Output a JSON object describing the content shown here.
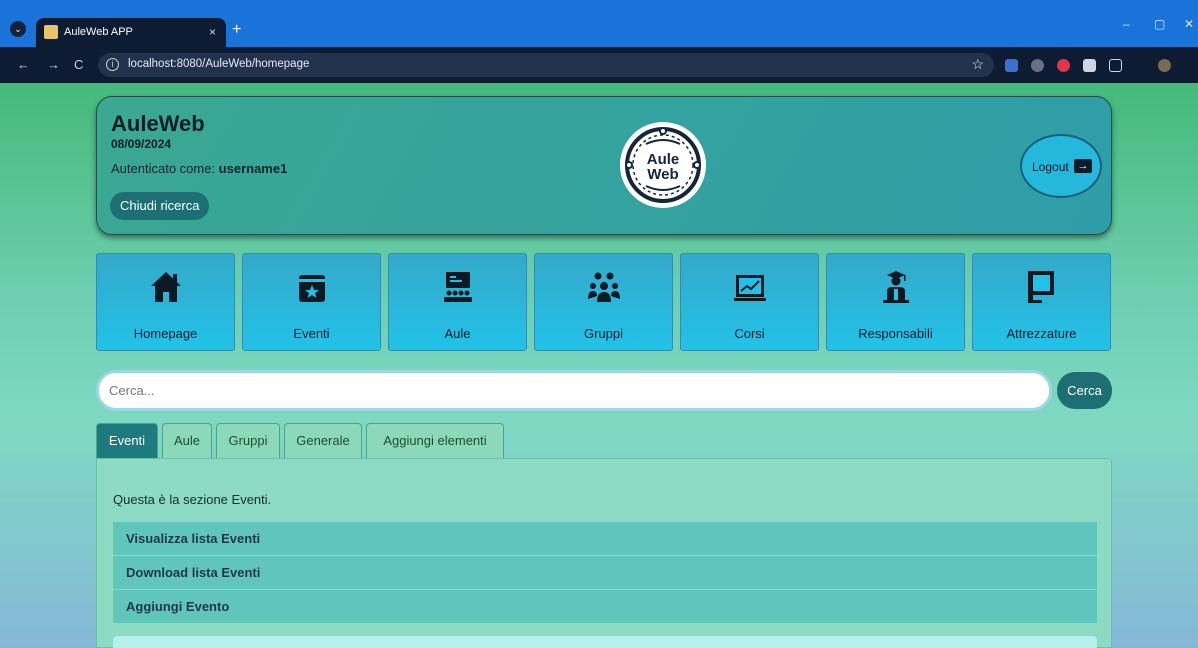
{
  "browser": {
    "tab_title": "AuleWeb APP",
    "tab_close": "×",
    "new_tab": "+",
    "url": "localhost:8080/AuleWeb/homepage",
    "info": "i",
    "star": "☆",
    "back": "←",
    "forward": "→",
    "reload": "C",
    "minimize": "–",
    "maximize": "▢",
    "close": "✕"
  },
  "header": {
    "brand": "AuleWeb",
    "date": "08/09/2024",
    "auth_prefix": "Autenticato come: ",
    "username": "username1",
    "close_search": "Chiudi ricerca",
    "logo_line1": "Aule",
    "logo_line2": "Web",
    "logout": "Logout",
    "logout_icon": "→"
  },
  "nav": [
    {
      "label": "Homepage",
      "icon": "home-icon"
    },
    {
      "label": "Eventi",
      "icon": "calendar-star-icon"
    },
    {
      "label": "Aule",
      "icon": "classroom-icon"
    },
    {
      "label": "Gruppi",
      "icon": "users-icon"
    },
    {
      "label": "Corsi",
      "icon": "chart-board-icon"
    },
    {
      "label": "Responsabili",
      "icon": "teacher-icon"
    },
    {
      "label": "Attrezzature",
      "icon": "computer-icon"
    }
  ],
  "search": {
    "placeholder": "Cerca...",
    "button": "Cerca"
  },
  "tabs": [
    "Eventi",
    "Aule",
    "Gruppi",
    "Generale",
    "Aggiungi elementi"
  ],
  "panel": {
    "intro": "Questa è la sezione Eventi.",
    "items": [
      "Visualizza lista Eventi",
      "Download lista Eventi",
      "Aggiungi Evento"
    ]
  },
  "colors": {
    "accent": "#1d6f73",
    "tile": "#22c2e8",
    "header": "#2f9da8"
  }
}
